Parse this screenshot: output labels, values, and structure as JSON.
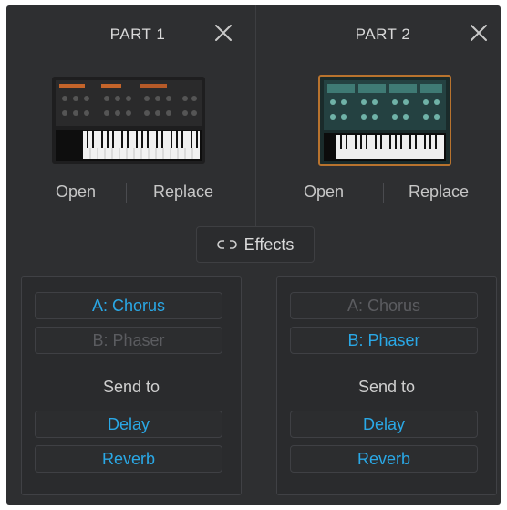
{
  "parts": [
    {
      "title": "PART 1",
      "actions": {
        "open": "Open",
        "replace": "Replace"
      },
      "effects": [
        {
          "label": "A: Chorus",
          "active": true
        },
        {
          "label": "B: Phaser",
          "active": false
        }
      ],
      "send_to": {
        "label": "Send to",
        "sends": [
          "Delay",
          "Reverb"
        ]
      }
    },
    {
      "title": "PART 2",
      "actions": {
        "open": "Open",
        "replace": "Replace"
      },
      "effects": [
        {
          "label": "A: Chorus",
          "active": false
        },
        {
          "label": "B: Phaser",
          "active": true
        }
      ],
      "send_to": {
        "label": "Send to",
        "sends": [
          "Delay",
          "Reverb"
        ]
      }
    }
  ],
  "effects_toggle": {
    "label": "Effects",
    "icon": "link-icon"
  },
  "icons": {
    "close": "close-icon",
    "link": "link-icon"
  },
  "colors": {
    "panel_bg": "#2e2f31",
    "active_effect": "#2aa8e6",
    "inactive_effect": "#5b5c60",
    "text": "#cfcfcf"
  }
}
